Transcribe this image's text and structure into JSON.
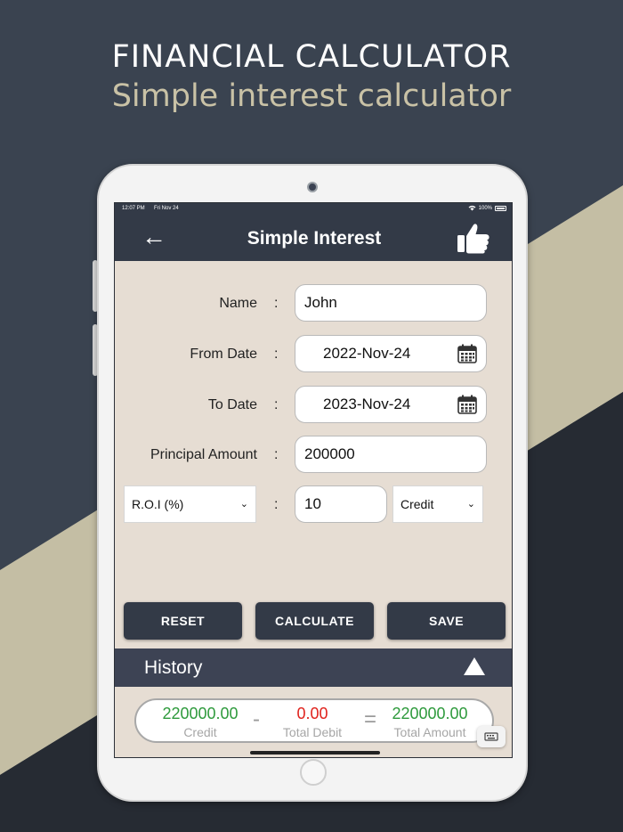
{
  "promo": {
    "headline": "FINANCIAL CALCULATOR",
    "subheadline": "Simple interest calculator"
  },
  "status_bar": {
    "time": "12:07 PM",
    "date": "Fri Nov 24",
    "battery": "100%"
  },
  "navbar": {
    "back_icon": "←",
    "title": "Simple Interest",
    "like_icon": "thumbs-up-icon"
  },
  "form": {
    "colon": ":",
    "name_label": "Name",
    "name_value": "John",
    "from_date_label": "From Date",
    "from_date_value": "2022-Nov-24",
    "to_date_label": "To Date",
    "to_date_value": "2023-Nov-24",
    "principal_label": "Principal Amount",
    "principal_value": "200000",
    "roi_select": "R.O.I (%)",
    "roi_value": "10",
    "type_select": "Credit",
    "chevron": "⌄"
  },
  "buttons": {
    "reset": "RESET",
    "calculate": "CALCULATE",
    "save": "SAVE"
  },
  "history": {
    "label": "History"
  },
  "summary": {
    "credit_value": "220000.00",
    "credit_label": "Credit",
    "minus": "-",
    "debit_value": "0.00",
    "debit_label": "Total Debit",
    "equals": "=",
    "total_value": "220000.00",
    "total_label": "Total Amount"
  },
  "colors": {
    "background_dark": "#3a4350",
    "background_beige": "#c4bea4",
    "navbar": "#333a47",
    "form_bg": "#e6ddd3",
    "credit_green": "#2e9a3c",
    "debit_red": "#e0221c"
  }
}
